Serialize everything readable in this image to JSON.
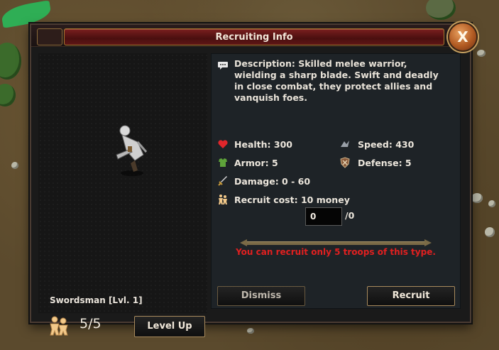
{
  "window": {
    "title": "Recruiting Info",
    "close_label": "X"
  },
  "unit": {
    "name": "Swordsman [Lvl. 1]",
    "troop_count": "5/5",
    "level_up_label": "Level Up"
  },
  "info": {
    "description": "Description: Skilled melee warrior, wielding a sharp blade. Swift and deadly in close combat, they protect allies and vanquish foes.",
    "health": "Health: 300",
    "speed": "Speed: 430",
    "armor": "Armor: 5",
    "defense": "Defense: 5",
    "damage": "Damage: 0 - 60",
    "recruit_cost": "Recruit cost: 10 money"
  },
  "recruit_input": {
    "value": "0",
    "max_label": "/0"
  },
  "warning": "You can recruit only 5 troops of this type.",
  "buttons": {
    "dismiss": "Dismiss",
    "recruit": "Recruit"
  },
  "colors": {
    "warning": "#e02020",
    "title_plate": "#7a1f1f",
    "button_border": "#a88a5c"
  }
}
